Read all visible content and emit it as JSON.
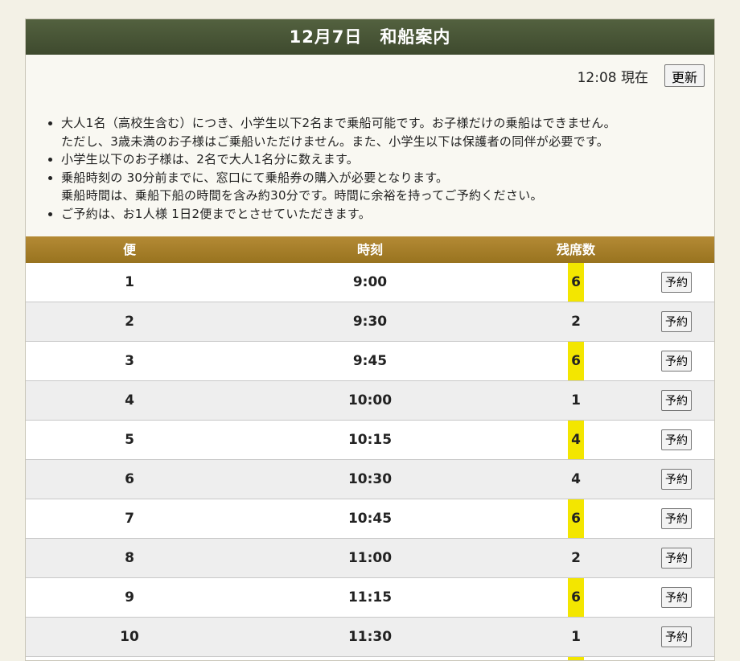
{
  "header": {
    "title": "12月7日　和船案内"
  },
  "status": {
    "time_text": "12:08 現在",
    "update_label": "更新"
  },
  "notes": [
    "大人1名（高校生含む）につき、小学生以下2名まで乗船可能です。お子様だけの乗船はできません。",
    "ただし、3歳未満のお子様はご乗船いただけません。また、小学生以下は保護者の同伴が必要です。",
    "小学生以下のお子様は、2名で大人1名分に数えます。",
    "乗船時刻の 30分前までに、窓口にて乗船券の購入が必要となります。",
    "乗船時間は、乗船下船の時間を含み約30分です。時間に余裕を持ってご予約ください。",
    "ご予約は、お1人様 1日2便までとさせていただきます。"
  ],
  "table": {
    "headers": {
      "bin": "便",
      "time": "時刻",
      "seats": "残席数"
    },
    "reserve_label": "予約",
    "highlight_color": "#f3e600",
    "rows": [
      {
        "bin": "1",
        "time": "9:00",
        "seats": "6"
      },
      {
        "bin": "2",
        "time": "9:30",
        "seats": "2"
      },
      {
        "bin": "3",
        "time": "9:45",
        "seats": "6"
      },
      {
        "bin": "4",
        "time": "10:00",
        "seats": "1"
      },
      {
        "bin": "5",
        "time": "10:15",
        "seats": "4"
      },
      {
        "bin": "6",
        "time": "10:30",
        "seats": "4"
      },
      {
        "bin": "7",
        "time": "10:45",
        "seats": "6"
      },
      {
        "bin": "8",
        "time": "11:00",
        "seats": "2"
      },
      {
        "bin": "9",
        "time": "11:15",
        "seats": "6"
      },
      {
        "bin": "10",
        "time": "11:30",
        "seats": "1"
      }
    ]
  }
}
